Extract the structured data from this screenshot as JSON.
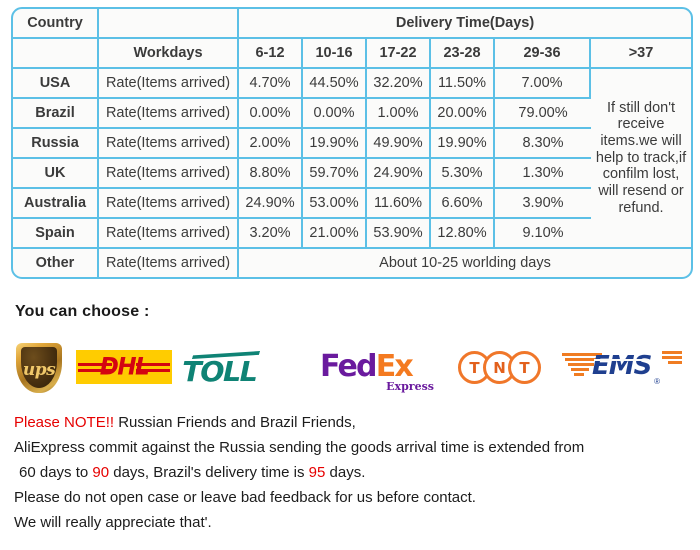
{
  "table": {
    "header_row1": {
      "country_label": "Country",
      "blank_label": "",
      "delivery_time_label": "Delivery Time(Days)"
    },
    "header_row2": {
      "country_blank": "",
      "workdays_label": "Workdays",
      "day_ranges": [
        "6-12",
        "10-16",
        "17-22",
        "23-28",
        "29-36",
        ">37"
      ]
    },
    "rate_label": "Rate(Items arrived)",
    "rows": [
      {
        "country": "USA",
        "rate_label": "Rate(Items arrived)",
        "values": [
          "4.70%",
          "44.50%",
          "32.20%",
          "11.50%",
          "7.00%"
        ]
      },
      {
        "country": "Brazil",
        "rate_label": "Rate(Items arrived)",
        "values": [
          "0.00%",
          "0.00%",
          "1.00%",
          "20.00%",
          "79.00%"
        ]
      },
      {
        "country": "Russia",
        "rate_label": "Rate(Items arrived)",
        "values": [
          "2.00%",
          "19.90%",
          "49.90%",
          "19.90%",
          "8.30%"
        ]
      },
      {
        "country": "UK",
        "rate_label": "Rate(Items arrived)",
        "values": [
          "8.80%",
          "59.70%",
          "24.90%",
          "5.30%",
          "1.30%"
        ]
      },
      {
        "country": "Australia",
        "rate_label": "Rate(Items arrived)",
        "values": [
          "24.90%",
          "53.00%",
          "11.60%",
          "6.60%",
          "3.90%"
        ]
      },
      {
        "country": "Spain",
        "rate_label": "Rate(Items arrived)",
        "values": [
          "3.20%",
          "21.00%",
          "53.90%",
          "12.80%",
          "9.10%"
        ]
      }
    ],
    "notes_cell": "If still don't receive items.we will help to track,if confilm lost, will resend or refund.",
    "other_row": {
      "country": "Other",
      "rate_label": "Rate(Items arrived)",
      "note": "About 10-25 worlding days"
    },
    "border_color": "#5cc0e6",
    "cell_background": "#fbfbfa"
  },
  "couriers": {
    "heading": "You can choose :",
    "items": [
      {
        "name": "ups-logo",
        "text": "ups",
        "color": "#d8ae4c"
      },
      {
        "name": "dhl-logo",
        "text": "DHL",
        "color": "#d40511",
        "background": "#ffcc00"
      },
      {
        "name": "toll-logo",
        "text": "TOLL",
        "color": "#0f8375"
      },
      {
        "name": "fedex-logo",
        "text_primary": "Fed",
        "text_secondary": "Ex",
        "subtitle": "Express",
        "color_primary": "#6a1a9e",
        "color_secondary": "#f47a20"
      },
      {
        "name": "tnt-logo",
        "letters": [
          "T",
          "N",
          "T"
        ],
        "color": "#f0772a"
      },
      {
        "name": "ems-logo",
        "text": "EMS",
        "color": "#1f3f8f",
        "accent": "#f07c22",
        "registered": "®"
      }
    ]
  },
  "notice": {
    "line1_red": "Please NOTE!!",
    "line1_rest": " Russian Friends and Brazil Friends,",
    "line2": "AliExpress commit against the Russia sending the goods arrival time is extended from",
    "line3_a": " 60 days to ",
    "line3_red1": "90",
    "line3_b": " days, Brazil's delivery time is ",
    "line3_red2": "95",
    "line3_c": " days.",
    "line4": "Please do not open case or leave bad feedback for us before contact.",
    "line5": "We will really appreciate that'.",
    "highlight_color": "#e60000"
  }
}
